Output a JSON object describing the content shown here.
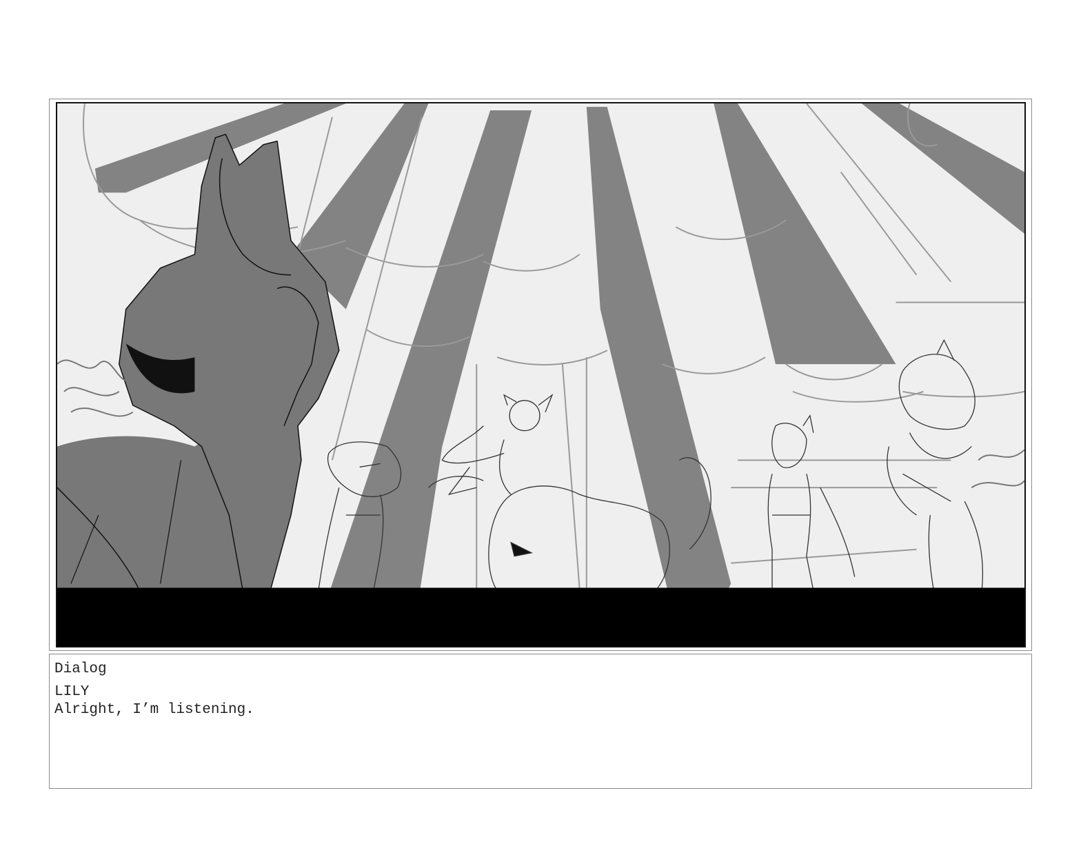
{
  "panel": {
    "colors": {
      "background": "#efefef",
      "stripe": "#838383",
      "silhouette": "#787878",
      "ink": "#111111",
      "bar": "#000000"
    },
    "scene": "storyboard-sketch"
  },
  "dialog": {
    "heading": "Dialog",
    "speaker": "LILY",
    "line": "Alright, I’m listening."
  }
}
